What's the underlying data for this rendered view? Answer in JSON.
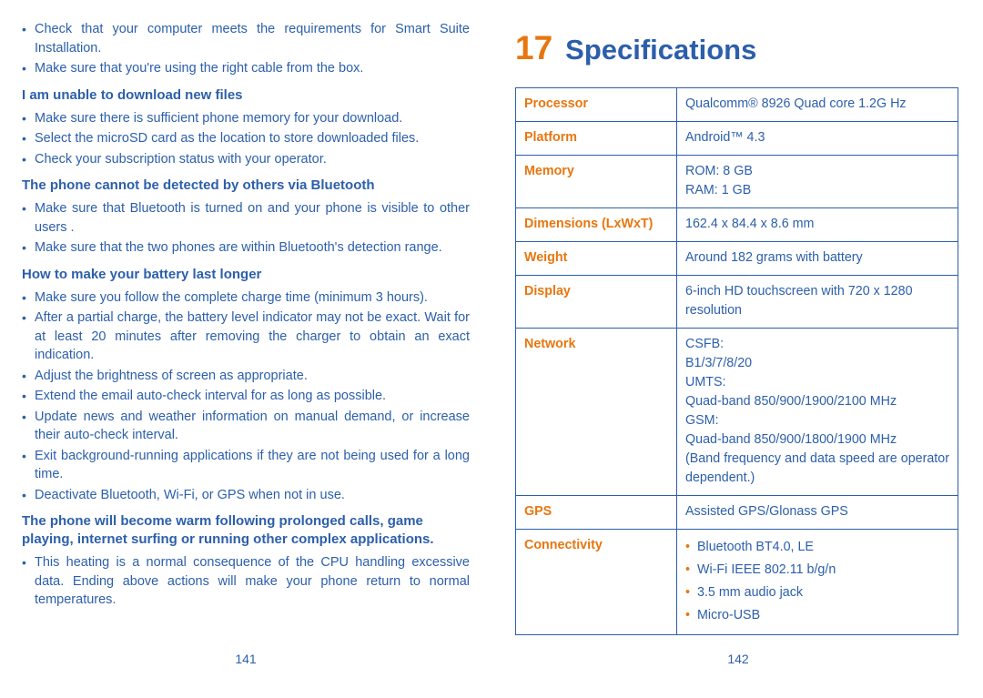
{
  "left_page": {
    "page_number": "141",
    "blocks": [
      {
        "type": "bullets",
        "items": [
          "Check that your computer meets the requirements for Smart Suite Installation.",
          "Make sure that you're using the right cable from the box."
        ]
      },
      {
        "type": "heading",
        "text": "I am unable to download new files"
      },
      {
        "type": "bullets",
        "items": [
          "Make sure there is sufficient phone memory for your download.",
          "Select the microSD card as the location to store downloaded files.",
          "Check your subscription status with your operator."
        ]
      },
      {
        "type": "heading",
        "text": "The phone cannot be detected by others via Bluetooth"
      },
      {
        "type": "bullets",
        "items": [
          "Make sure that Bluetooth is turned on and your phone is visible to other users .",
          "Make sure that the two phones are within Bluetooth's detection range."
        ]
      },
      {
        "type": "heading",
        "text": "How to make your battery last longer"
      },
      {
        "type": "bullets",
        "items": [
          "Make sure you follow the complete charge time (minimum 3 hours).",
          "After a partial charge, the battery level indicator may not be exact. Wait for at least 20 minutes after removing the charger to obtain an exact indication.",
          "Adjust the brightness of screen as appropriate.",
          "Extend the email auto-check interval for as long as possible.",
          "Update news and weather information on manual demand, or increase their auto-check interval.",
          "Exit background-running applications if they are not being used for a long time.",
          "Deactivate Bluetooth, Wi-Fi, or GPS when not in use."
        ]
      },
      {
        "type": "heading",
        "text": "The phone will become warm following prolonged calls, game playing, internet surfing or running other complex applications."
      },
      {
        "type": "bullets",
        "items": [
          "This heating is a normal consequence of the CPU handling excessive data. Ending above actions will make your phone return to normal temperatures."
        ]
      }
    ]
  },
  "right_page": {
    "page_number": "142",
    "chapter_number": "17",
    "chapter_title": "Specifications",
    "spec_rows": [
      {
        "label": "Processor",
        "lines": [
          "Qualcomm® 8926 Quad core 1.2G Hz"
        ]
      },
      {
        "label": "Platform",
        "lines": [
          "Android™ 4.3"
        ]
      },
      {
        "label": "Memory",
        "lines": [
          "ROM: 8 GB",
          "RAM: 1 GB"
        ]
      },
      {
        "label": "Dimensions (LxWxT)",
        "lines": [
          "162.4 x 84.4 x 8.6 mm"
        ]
      },
      {
        "label": "Weight",
        "lines": [
          "Around 182 grams with battery"
        ]
      },
      {
        "label": "Display",
        "lines": [
          "6-inch HD touchscreen with 720 x 1280 resolution"
        ]
      },
      {
        "label": "Network",
        "lines": [
          "CSFB:",
          "B1/3/7/8/20",
          "UMTS:",
          "Quad-band 850/900/1900/2100 MHz",
          "GSM:",
          "Quad-band 850/900/1800/1900 MHz",
          "(Band frequency and data speed are operator dependent.)"
        ]
      },
      {
        "label": "GPS",
        "lines": [
          "Assisted GPS/Glonass GPS"
        ]
      },
      {
        "label": "Connectivity",
        "bullets": [
          "Bluetooth BT4.0, LE",
          "Wi-Fi IEEE 802.11 b/g/n",
          "3.5 mm audio jack",
          "Micro-USB"
        ]
      }
    ]
  },
  "colors": {
    "blue": "#2c5fab",
    "orange": "#e8760f"
  }
}
